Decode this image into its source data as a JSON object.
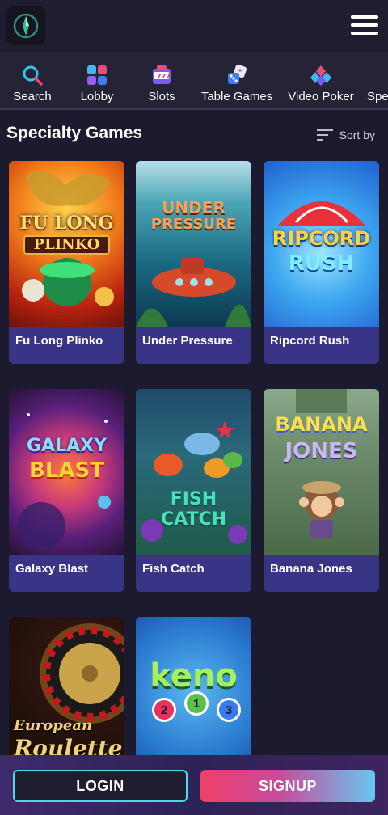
{
  "header": {
    "logo_icon": "compass-gem-logo",
    "menu_icon": "hamburger-menu-icon"
  },
  "nav": {
    "items": [
      {
        "label": "Search",
        "icon": "search-icon"
      },
      {
        "label": "Lobby",
        "icon": "lobby-grid-icon"
      },
      {
        "label": "Slots",
        "icon": "slot-machine-icon"
      },
      {
        "label": "Table Games",
        "icon": "dice-icon"
      },
      {
        "label": "Video Poker",
        "icon": "card-suits-icon"
      },
      {
        "label": "Spe",
        "icon": ""
      }
    ],
    "active_color": "#e8315b"
  },
  "section": {
    "title": "Specialty Games",
    "sort_label": "Sort by"
  },
  "games": [
    {
      "title": "Fu Long Plinko",
      "art_line1": "FU LONG",
      "art_line2": "PLINKO"
    },
    {
      "title": "Under Pressure",
      "art_line1": "UNDER",
      "art_line2": "PRESSURE"
    },
    {
      "title": "Ripcord Rush",
      "art_line1": "RIPCORD",
      "art_line2": "RUSH"
    },
    {
      "title": "Galaxy Blast",
      "art_line1": "GALAXY",
      "art_line2": "BLAST"
    },
    {
      "title": "Fish Catch",
      "art_line1": "FISH CATCH",
      "art_line2": ""
    },
    {
      "title": "Banana Jones",
      "art_line1": "BANANA",
      "art_line2": "JONES"
    },
    {
      "title": "",
      "art_line1": "European",
      "art_line2": "Roulette"
    },
    {
      "title": "",
      "art_line1": "keno",
      "art_line2": ""
    }
  ],
  "keno_balls": [
    "2",
    "1",
    "3"
  ],
  "footer": {
    "login_label": "LOGIN",
    "signup_label": "SIGNUP"
  }
}
